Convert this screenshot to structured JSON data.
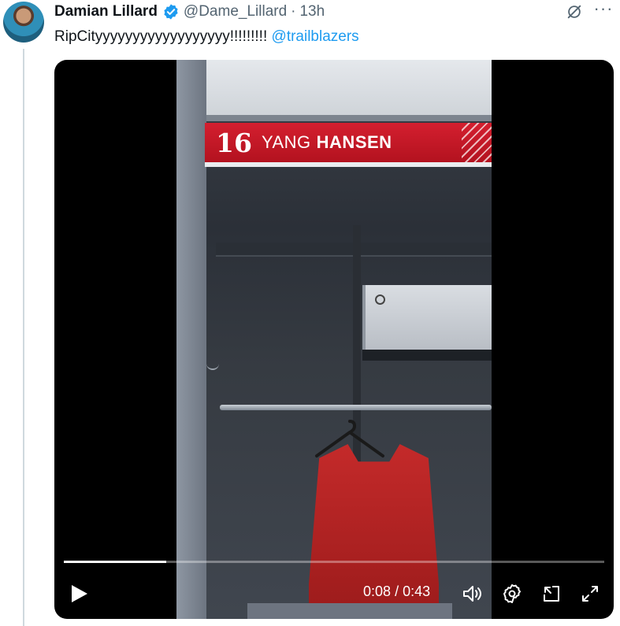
{
  "tweet": {
    "author_name": "Damian Lillard",
    "handle": "@Dame_Lillard",
    "separator": "·",
    "time_ago": "13h",
    "text": "RipCityyyyyyyyyyyyyyyyyy!!!!!!!!!",
    "mention": "@trailblazers",
    "more_label": "···"
  },
  "video": {
    "nameplate": {
      "number": "16",
      "first_name": "YANG",
      "last_name": "HANSEN"
    },
    "progress_fraction": 0.19,
    "current_time": "0:08",
    "time_separator": "/",
    "duration": "0:43"
  },
  "icons": {
    "verified": "verified-badge-icon",
    "grok": "grok-icon",
    "more": "more-icon",
    "play": "play-icon",
    "volume": "volume-icon",
    "settings": "settings-icon",
    "pip": "picture-in-picture-icon",
    "fullscreen": "fullscreen-icon"
  },
  "colors": {
    "accent": "#1d9bf0",
    "text": "#0f1419",
    "secondary": "#536471",
    "nameplate_red": "#c8192a"
  }
}
